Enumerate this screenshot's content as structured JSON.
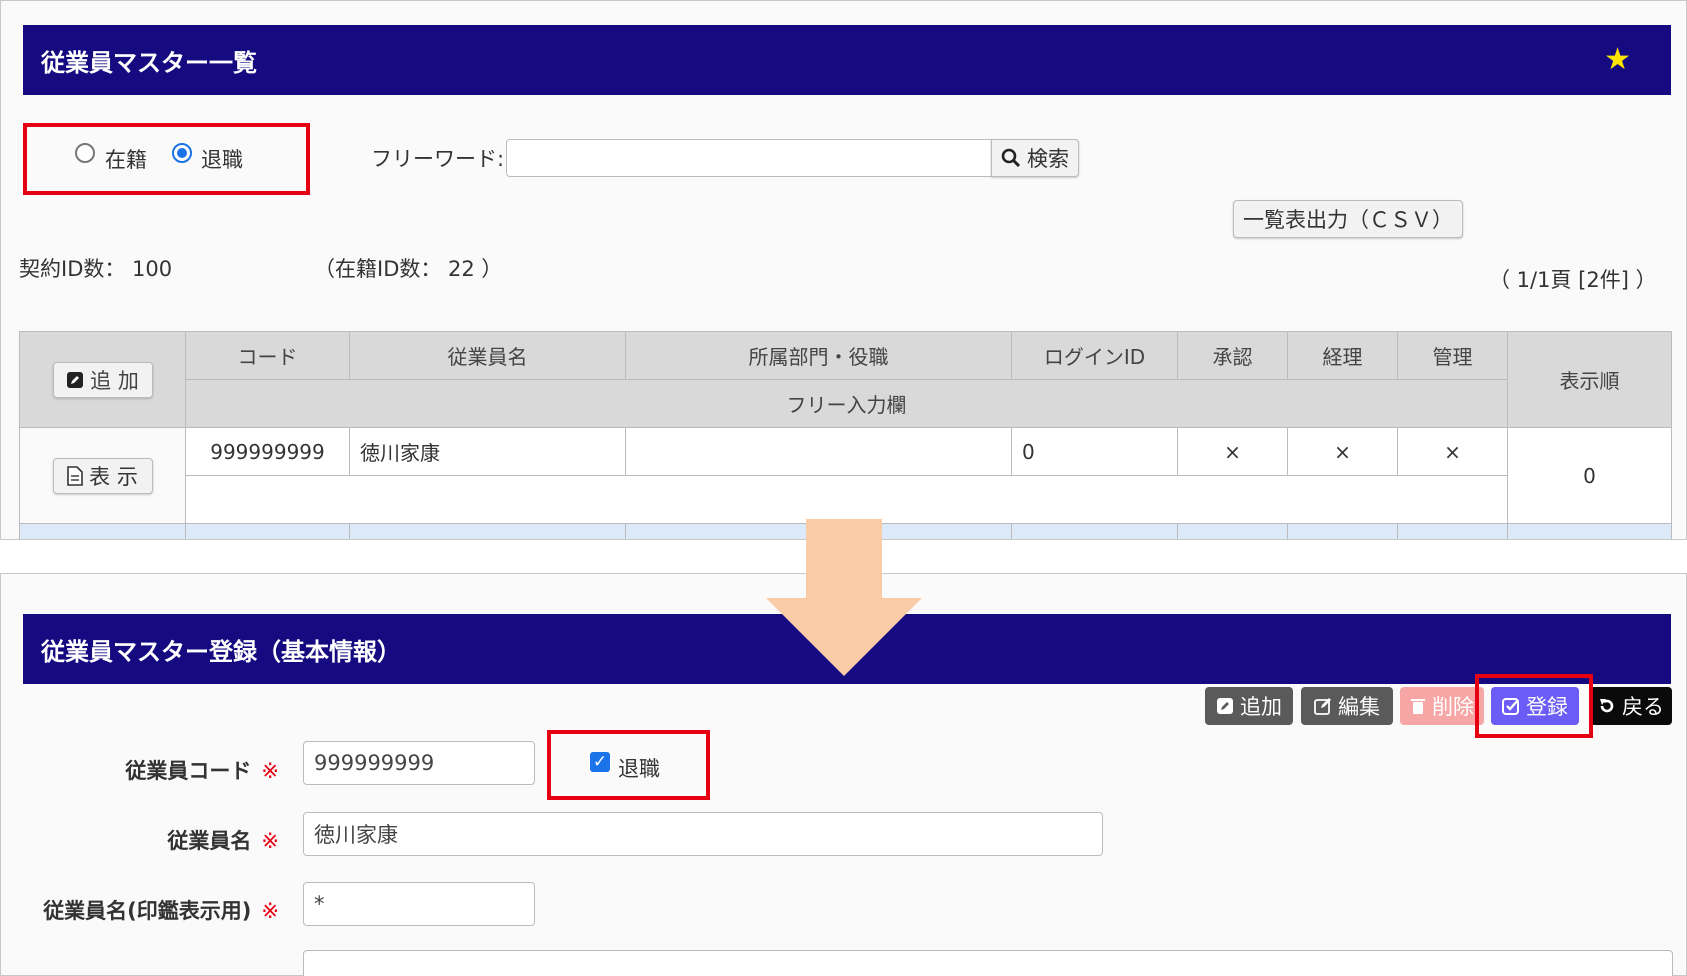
{
  "list_screen": {
    "title": "従業員マスター一覧",
    "status_filter": {
      "options": [
        "在籍",
        "退職"
      ],
      "selected": "退職"
    },
    "freeword_label": "フリーワード:",
    "freeword_value": "",
    "search_button": "検索",
    "csv_button": "一覧表出力（ＣＳＶ）",
    "contract_id_count": "契約ID数： 100",
    "active_id_count": "（在籍ID数： 22 ）",
    "pagination": "（ 1/1頁 [2件] ）",
    "table": {
      "add_button": "追 加",
      "headers": {
        "code": "コード",
        "name": "従業員名",
        "dept": "所属部門・役職",
        "login": "ログインID",
        "approve": "承認",
        "accounting": "経理",
        "admin": "管理",
        "order": "表示順",
        "free": "フリー入力欄"
      },
      "rows": [
        {
          "view_button": "表 示",
          "code": "999999999",
          "name": "徳川家康",
          "dept": "",
          "login": "0",
          "approve": "×",
          "accounting": "×",
          "admin": "×",
          "order": "0"
        }
      ]
    }
  },
  "register_screen": {
    "title": "従業員マスター登録（基本情報）",
    "actions": {
      "add": "追加",
      "edit": "編集",
      "delete": "削除",
      "register": "登録",
      "back": "戻る"
    },
    "fields": {
      "code": {
        "label": "従業員コード",
        "value": "999999999"
      },
      "retired": {
        "label": "退職",
        "checked": true
      },
      "name": {
        "label": "従業員名",
        "value": "徳川家康"
      },
      "seal_name": {
        "label": "従業員名(印鑑表示用)",
        "value": "*"
      },
      "required_mark": "※"
    }
  },
  "colors": {
    "title_bar": "#160a80",
    "highlight_box": "#e60012",
    "arrow": "#f9cba7",
    "register_button": "#6a5cf5",
    "delete_button": "#f7a6a6"
  }
}
